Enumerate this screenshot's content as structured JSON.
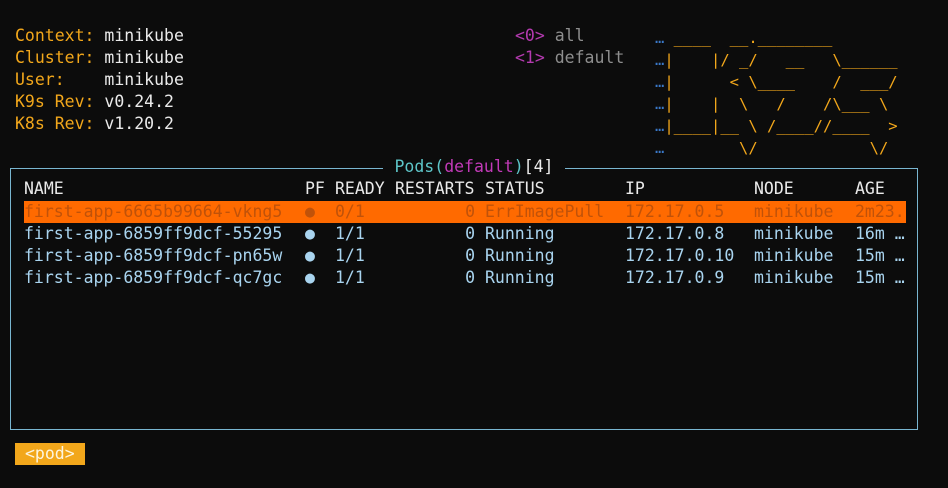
{
  "header": {
    "context_label": "Context:",
    "context_value": "minikube",
    "cluster_label": "Cluster:",
    "cluster_value": "minikube",
    "user_label": "User:",
    "user_value": "minikube",
    "k9s_rev_label": "K9s Rev:",
    "k9s_rev_value": "v0.24.2",
    "k8s_rev_label": "K8s Rev:",
    "k8s_rev_value": "v1.20.2"
  },
  "namespaces": [
    {
      "key": "<0>",
      "name": "all"
    },
    {
      "key": "<1>",
      "name": "default"
    }
  ],
  "logo": {
    "lines": [
      " ____  __.________       ",
      "|    |/ _/   __   \\______",
      "|      < \\____    /  ___/",
      "|    |  \\   /    /\\___ \\ ",
      "|____|__ \\ /____//____  >",
      "        \\/            \\/ "
    ]
  },
  "view": {
    "resource": "Pods",
    "paren_open": "(",
    "namespace": "default",
    "paren_close": ")",
    "count": "[4]"
  },
  "table": {
    "columns": [
      "NAME",
      "PF",
      "READY",
      "RESTARTS",
      "STATUS",
      "IP",
      "NODE",
      "AGE"
    ],
    "rows": [
      {
        "name": "first-app-6665b99664-vkng5",
        "pf": "●",
        "ready": "0/1",
        "restarts": "0",
        "status": "ErrImagePull",
        "ip": "172.17.0.5",
        "node": "minikube",
        "age": "2m23.",
        "selected": true
      },
      {
        "name": "first-app-6859ff9dcf-55295",
        "pf": "●",
        "ready": "1/1",
        "restarts": "0",
        "status": "Running",
        "ip": "172.17.0.8",
        "node": "minikube",
        "age": "16m …",
        "selected": false
      },
      {
        "name": "first-app-6859ff9dcf-pn65w",
        "pf": "●",
        "ready": "1/1",
        "restarts": "0",
        "status": "Running",
        "ip": "172.17.0.10",
        "node": "minikube",
        "age": "15m …",
        "selected": false
      },
      {
        "name": "first-app-6859ff9dcf-qc7gc",
        "pf": "●",
        "ready": "1/1",
        "restarts": "0",
        "status": "Running",
        "ip": "172.17.0.9",
        "node": "minikube",
        "age": "15m …",
        "selected": false
      }
    ]
  },
  "crumbs": [
    "<pod>"
  ],
  "colors": {
    "label": "#f2a71b",
    "selected_row_bg": "#ff6a00",
    "row_text": "#a9d4ef",
    "border": "#79b6d1",
    "namespace_key": "#b43ab0"
  }
}
